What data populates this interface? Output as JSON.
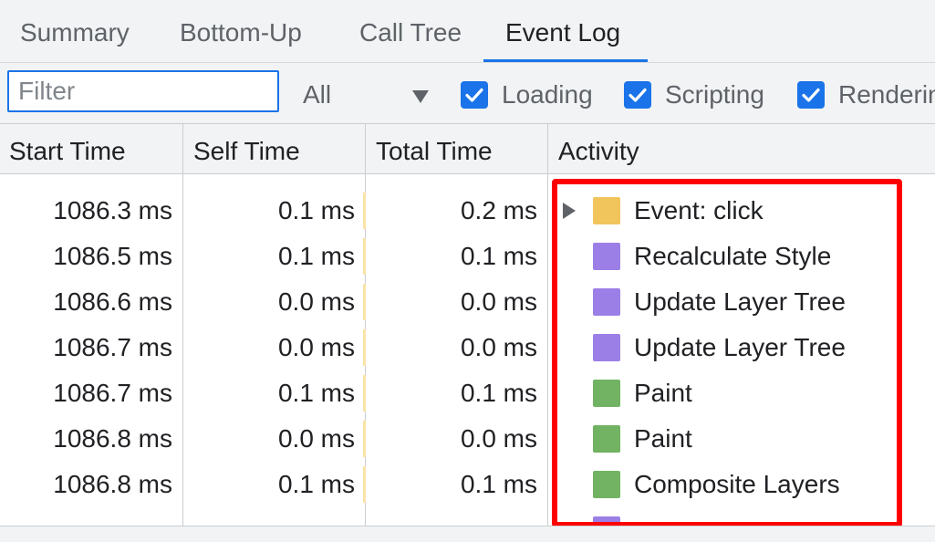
{
  "tabs": [
    {
      "label": "Summary"
    },
    {
      "label": "Bottom-Up"
    },
    {
      "label": "Call Tree"
    },
    {
      "label": "Event Log"
    }
  ],
  "active_tab": "Event Log",
  "toolbar": {
    "filter_placeholder": "Filter",
    "filter_value": "",
    "select_value": "All",
    "checkboxes": [
      {
        "label": "Loading",
        "checked": true
      },
      {
        "label": "Scripting",
        "checked": true
      },
      {
        "label": "Renderin",
        "checked": true
      }
    ]
  },
  "columns": [
    "Start Time",
    "Self Time",
    "Total Time",
    "Activity"
  ],
  "rows": [
    {
      "start": "1086.3 ms",
      "self": "0.1 ms",
      "total": "0.2 ms",
      "activity": "Event: click",
      "color": "#f2c55c",
      "expandable": true
    },
    {
      "start": "1086.5 ms",
      "self": "0.1 ms",
      "total": "0.1 ms",
      "activity": "Recalculate Style",
      "color": "#9b7fe6",
      "expandable": false
    },
    {
      "start": "1086.6 ms",
      "self": "0.0 ms",
      "total": "0.0 ms",
      "activity": "Update Layer Tree",
      "color": "#9b7fe6",
      "expandable": false
    },
    {
      "start": "1086.7 ms",
      "self": "0.0 ms",
      "total": "0.0 ms",
      "activity": "Update Layer Tree",
      "color": "#9b7fe6",
      "expandable": false
    },
    {
      "start": "1086.7 ms",
      "self": "0.1 ms",
      "total": "0.1 ms",
      "activity": "Paint",
      "color": "#71b363",
      "expandable": false
    },
    {
      "start": "1086.8 ms",
      "self": "0.0 ms",
      "total": "0.0 ms",
      "activity": "Paint",
      "color": "#71b363",
      "expandable": false
    },
    {
      "start": "1086.8 ms",
      "self": "0.1 ms",
      "total": "0.1 ms",
      "activity": "Composite Layers",
      "color": "#71b363",
      "expandable": false
    }
  ],
  "colors": {
    "accent": "#1a73e8",
    "highlight": "#ff0000",
    "scripting": "#f2c55c",
    "rendering": "#9b7fe6",
    "painting": "#71b363"
  }
}
